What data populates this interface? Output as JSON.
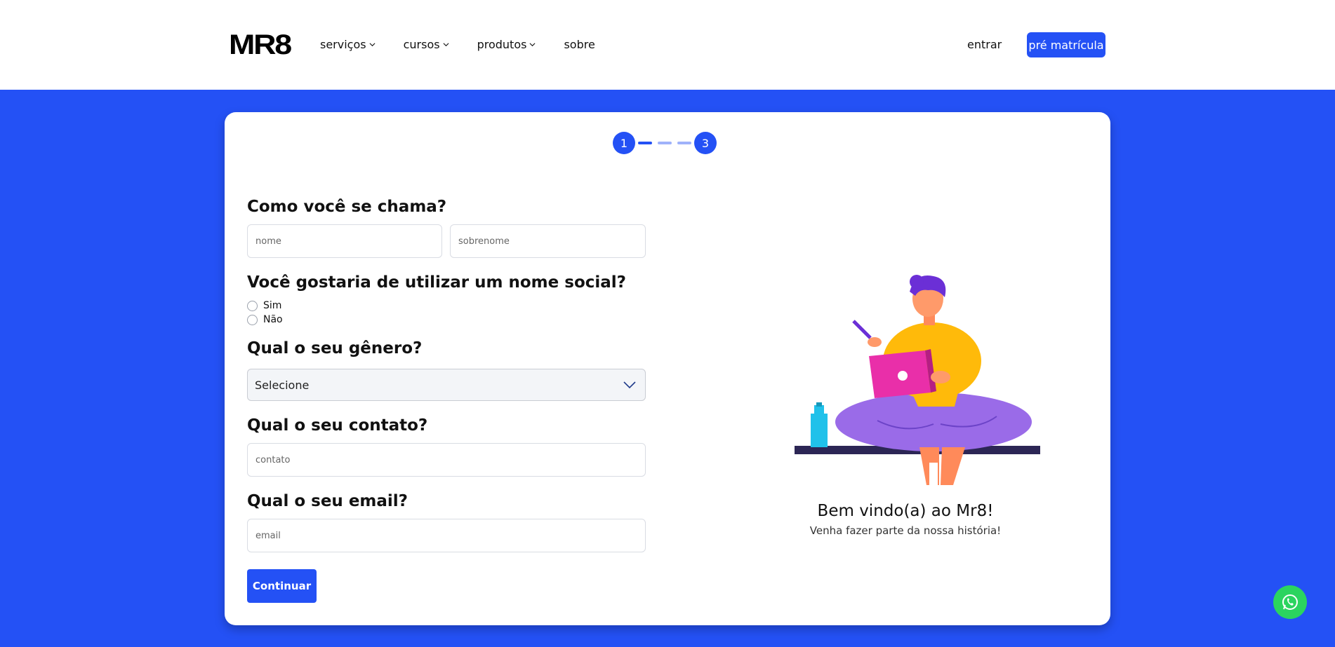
{
  "header": {
    "logo": "MR8",
    "nav": [
      {
        "label": "serviços",
        "has_dropdown": true
      },
      {
        "label": "cursos",
        "has_dropdown": true
      },
      {
        "label": "produtos",
        "has_dropdown": true
      },
      {
        "label": "sobre",
        "has_dropdown": false
      }
    ],
    "login_label": "entrar",
    "cta_label": "pré matrícula"
  },
  "stepper": {
    "first_step": "1",
    "last_step": "3",
    "current_step": 1
  },
  "form": {
    "name_question": "Como você se chama?",
    "first_name_placeholder": "nome",
    "last_name_placeholder": "sobrenome",
    "social_name_question": "Você gostaria de utilizar um nome social?",
    "social_name_options": [
      "Sim",
      "Não"
    ],
    "gender_question": "Qual o seu gênero?",
    "gender_selected": "Selecione",
    "contact_question": "Qual o seu contato?",
    "contact_placeholder": "contato",
    "email_question": "Qual o seu email?",
    "email_placeholder": "email",
    "continue_label": "Continuar"
  },
  "welcome": {
    "title": "Bem vindo(a) ao Mr8!",
    "subtitle": "Venha fazer parte da nossa história!"
  },
  "colors": {
    "brand_blue": "#2451F5",
    "whatsapp_green": "#2BD45F"
  },
  "icons": {
    "dropdown": "chevron-down-icon",
    "whatsapp": "whatsapp-icon"
  }
}
